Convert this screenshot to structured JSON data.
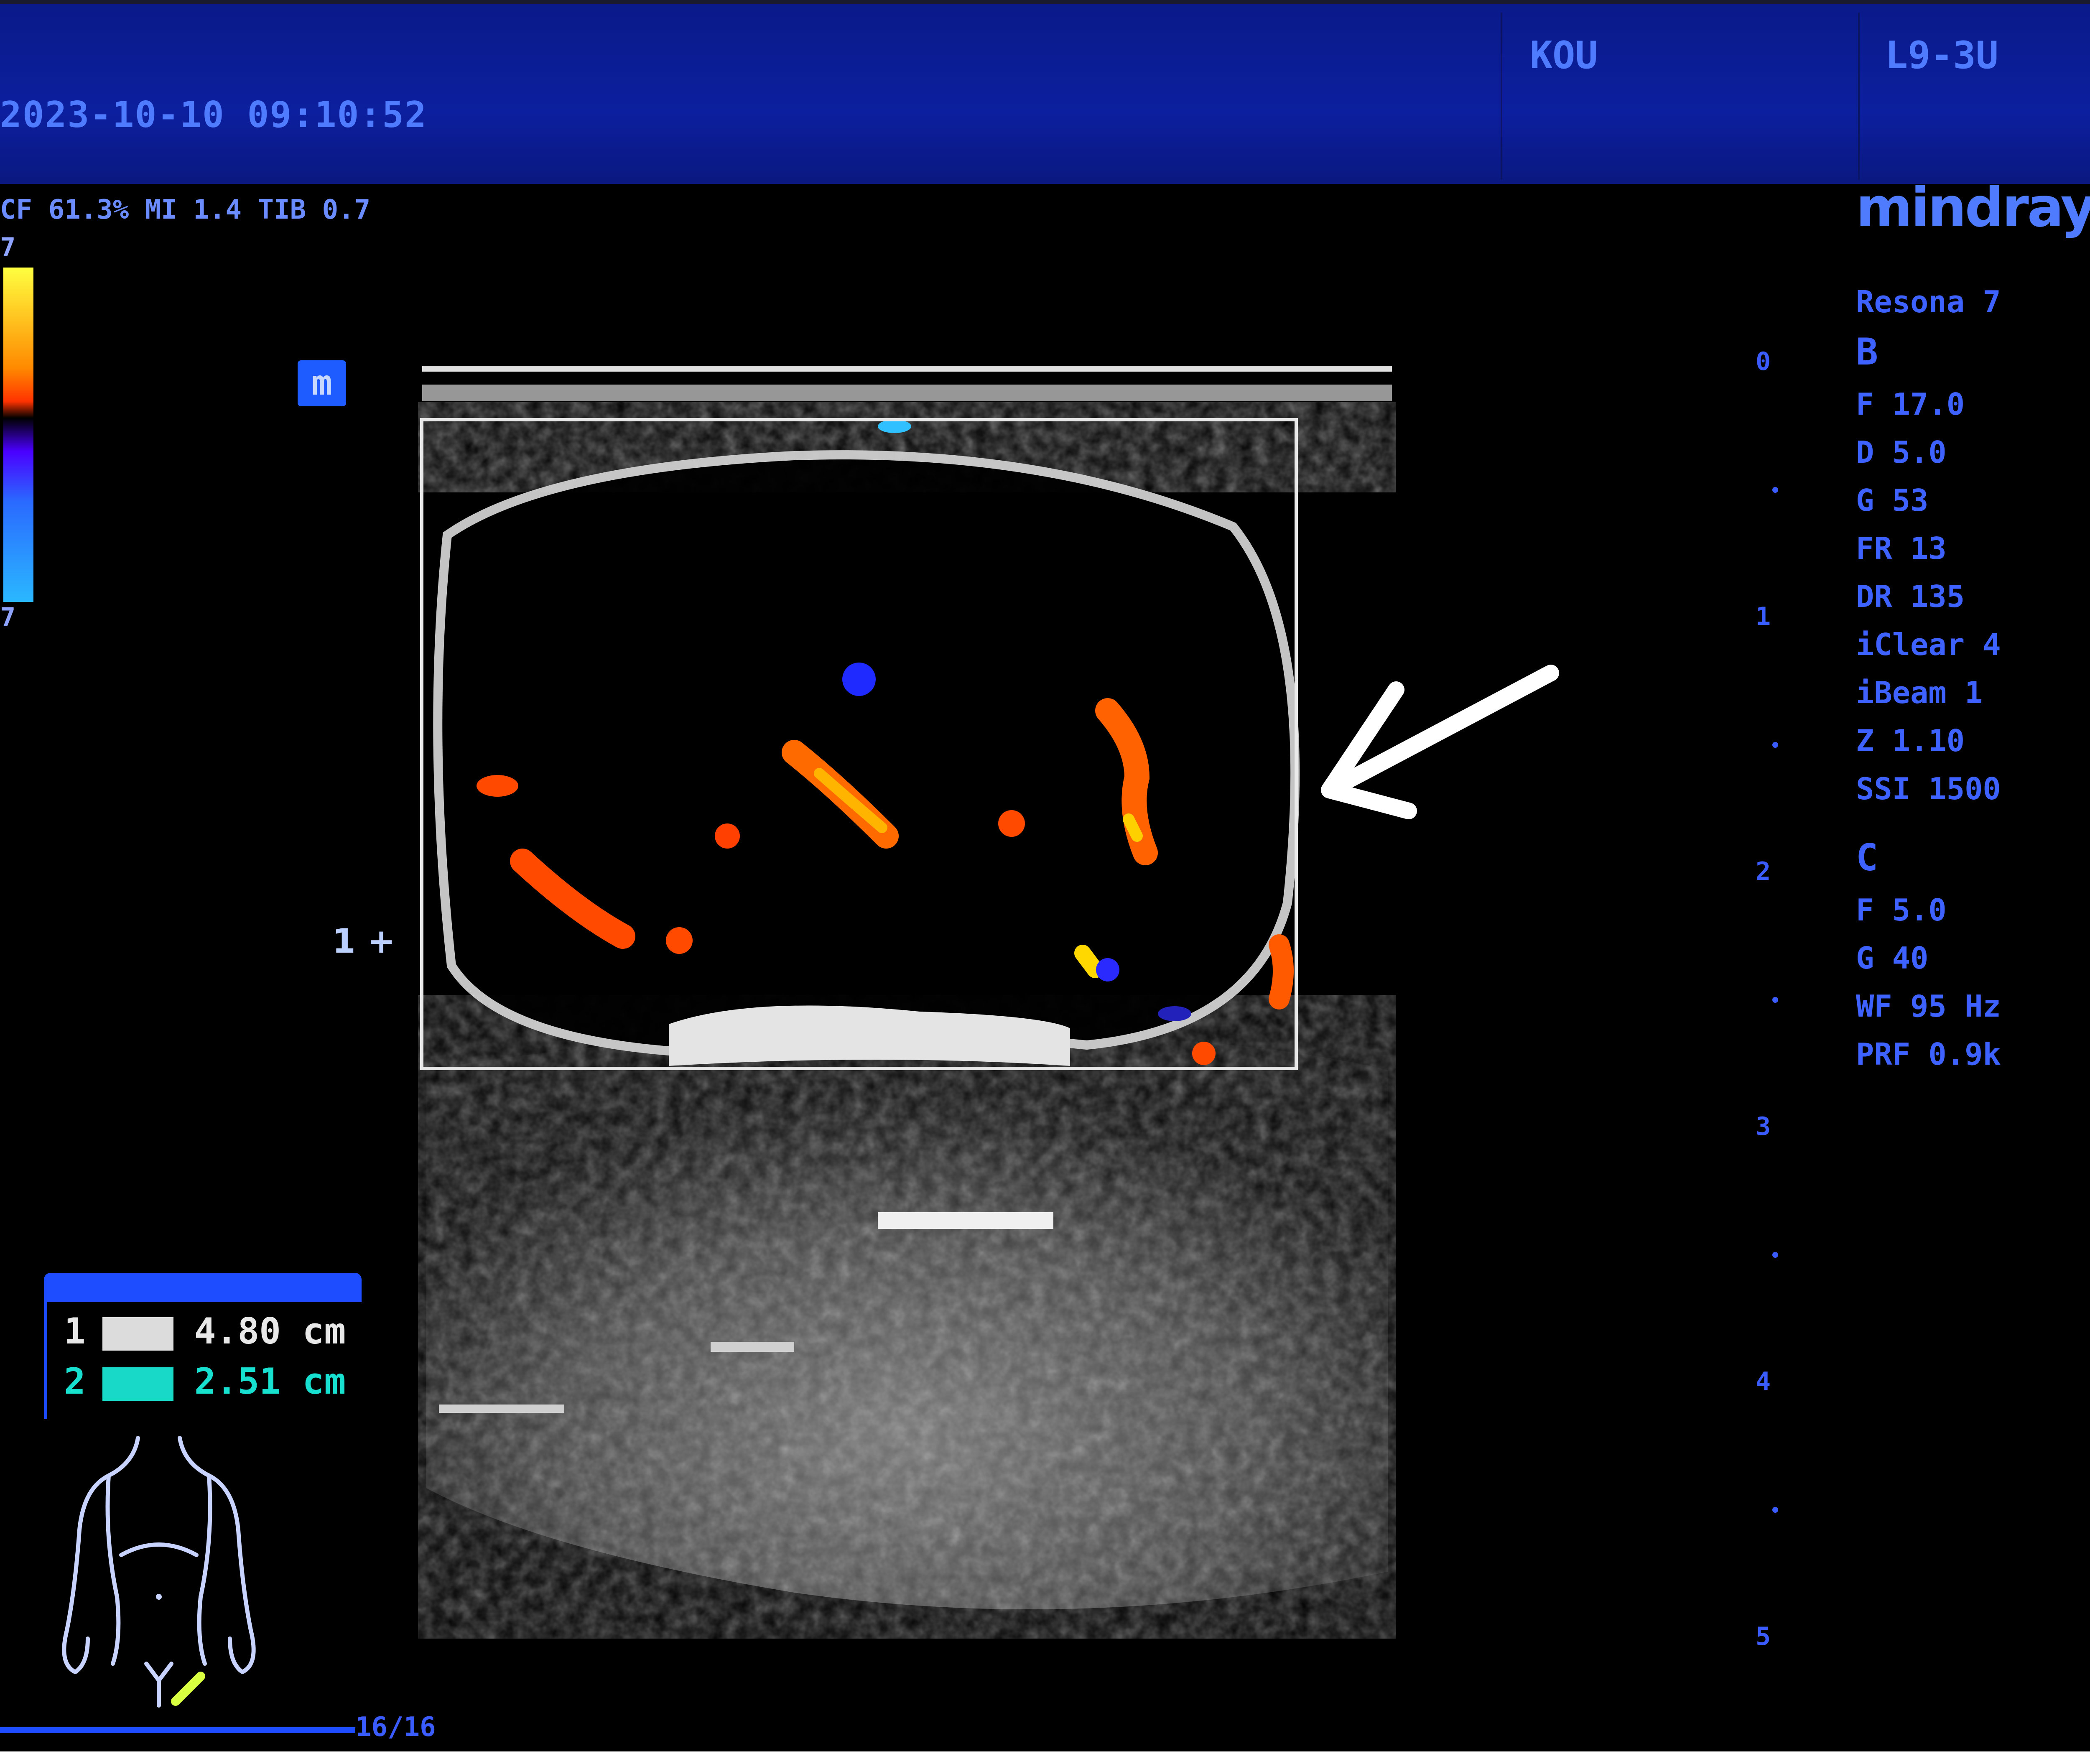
{
  "header": {
    "datetime": "2023-10-10    09:10:52",
    "preset_label": "KOU",
    "probe": "L9-3U"
  },
  "color_params": "CF 61.3%  MI 1.4  TIB 0.7",
  "color_scale": {
    "top": "7",
    "bottom": "7"
  },
  "mode_icon": "m",
  "focus_marker": "1 +",
  "brand": "mindray",
  "right_panel": {
    "model": "Resona 7",
    "b_mode": {
      "header": "B",
      "params": [
        "F 17.0",
        "D 5.0",
        "G 53",
        "FR 13",
        "DR 135",
        "iClear 4",
        "iBeam 1",
        "Z 1.10",
        "SSI 1500"
      ]
    },
    "c_mode": {
      "header": "C",
      "params": [
        "F 5.0",
        "G 40",
        "WF 95 Hz",
        "PRF 0.9k"
      ]
    }
  },
  "depth_scale": {
    "ticks": [
      "0",
      "1",
      "2",
      "3",
      "4",
      "5"
    ]
  },
  "measurements": [
    {
      "index": "1",
      "value": "4.80 cm",
      "color": "#e8e8e8"
    },
    {
      "index": "2",
      "value": "2.51 cm",
      "color": "#18e0d0"
    }
  ],
  "frame_counter": "16/16",
  "icons": {
    "mode": "m-mode-icon",
    "body_marker": "body-marker-icon",
    "arrow": "arrow-icon"
  },
  "colors": {
    "header_bg": "#0c1f9e",
    "text_blue": "#3e62ff",
    "measurement_2": "#18e0d0"
  }
}
